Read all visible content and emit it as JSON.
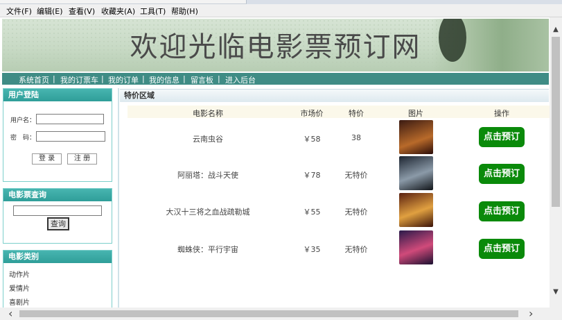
{
  "menu": [
    "文件(F)",
    "编辑(E)",
    "查看(V)",
    "收藏夹(A)",
    "工具(T)",
    "帮助(H)"
  ],
  "site": {
    "title": "欢迎光临电影票预订网"
  },
  "nav": [
    "系统首页",
    "我的订票车",
    "我的订单",
    "我的信息",
    "留言板",
    "进入后台"
  ],
  "login": {
    "heading": "用户登陆",
    "username_label": "用户名：",
    "password_label": "密　码：",
    "login_button": "登 录",
    "register_button": "注 册"
  },
  "search": {
    "heading": "电影票查询",
    "button": "查询"
  },
  "categories": {
    "heading": "电影类别",
    "items": [
      "动作片",
      "爱情片",
      "喜剧片"
    ]
  },
  "main": {
    "heading": "特价区域",
    "columns": [
      "电影名称",
      "市场价",
      "特价",
      "图片",
      "操作"
    ],
    "book_label": "点击预订",
    "rows": [
      {
        "name": "云南虫谷",
        "market_price": "￥58",
        "special": "38",
        "color_a": "#3a1a12",
        "color_b": "#b86a2a"
      },
      {
        "name": "阿丽塔：战斗天使",
        "market_price": "￥78",
        "special": "无特价",
        "color_a": "#1c2430",
        "color_b": "#8b9aa8"
      },
      {
        "name": "大汉十三将之血战疏勒城",
        "market_price": "￥55",
        "special": "无特价",
        "color_a": "#5a2010",
        "color_b": "#e0a040"
      },
      {
        "name": "蜘蛛侠：平行宇宙",
        "market_price": "￥35",
        "special": "无特价",
        "color_a": "#2a1a4a",
        "color_b": "#d04a7a"
      }
    ]
  }
}
